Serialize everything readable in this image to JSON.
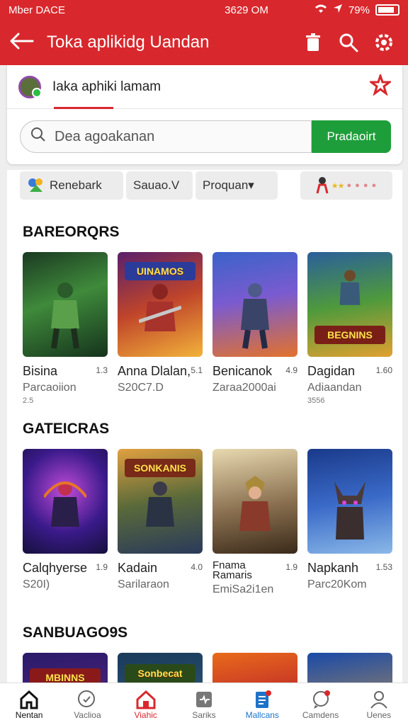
{
  "status_bar": {
    "carrier": "Mber DACE",
    "time": "3629 OM",
    "battery": "79%"
  },
  "app_bar": {
    "title": "Toka aplikidg Uandan"
  },
  "store": {
    "name": "Iaka aphiki lamam"
  },
  "search": {
    "placeholder": "Dea agoakanan",
    "button": "Pradaoirt"
  },
  "filters": [
    {
      "label": "Renebark"
    },
    {
      "label": "Sauao.V"
    },
    {
      "label": "Proquan▾"
    }
  ],
  "sections": [
    {
      "title": "BAREORQRS",
      "cards": [
        {
          "name": "Bisina",
          "num": "1.3",
          "sub": "Parcaoiion",
          "extra": "2.5"
        },
        {
          "name": "Anna Dlalan,",
          "num": "5.1",
          "sub": "S20C7.D",
          "extra": ""
        },
        {
          "name": "Benicanok",
          "num": "4.9",
          "sub": "Zaraa2000ai",
          "extra": ""
        },
        {
          "name": "Dagidan",
          "num": "1.60",
          "sub": "Adiaandan",
          "extra": "3556"
        }
      ]
    },
    {
      "title": "GATEICRAS",
      "cards": [
        {
          "name": "Calqhyerse",
          "num": "1.9",
          "sub": "S20I)",
          "extra": ""
        },
        {
          "name": "Kadain",
          "num": "4.0",
          "sub": "Sarilaraon",
          "extra": ""
        },
        {
          "name": "Fnama Ramaris",
          "num": "1.9",
          "sub": "EmiSa2i1en",
          "extra": ""
        },
        {
          "name": "Napkanh",
          "num": "1.53",
          "sub": "Parc20Kom",
          "extra": ""
        }
      ]
    },
    {
      "title": "SANBUAGO9S",
      "banners": [
        "MBINNS",
        "Sonbecat",
        "",
        ""
      ]
    }
  ],
  "thumb_banners_row1": [
    "",
    "UINAMOS",
    "",
    "BEGNINS"
  ],
  "thumb_banners_row2": [
    "",
    "SONKANIS",
    "",
    ""
  ],
  "bottom_nav": [
    {
      "label": "Nentan",
      "icon": "home-icon"
    },
    {
      "label": "Vaclioa",
      "icon": "search-circle-icon"
    },
    {
      "label": "Viahic",
      "icon": "store-house-icon"
    },
    {
      "label": "Sariks",
      "icon": "box-icon"
    },
    {
      "label": "Mallcans",
      "icon": "list-doc-icon"
    },
    {
      "label": "Camdens",
      "icon": "chat-icon"
    },
    {
      "label": "Uenes",
      "icon": "user-icon"
    }
  ],
  "colors": {
    "accent": "#d8282d",
    "green": "#1e9e3a",
    "blue": "#1e73c8"
  }
}
